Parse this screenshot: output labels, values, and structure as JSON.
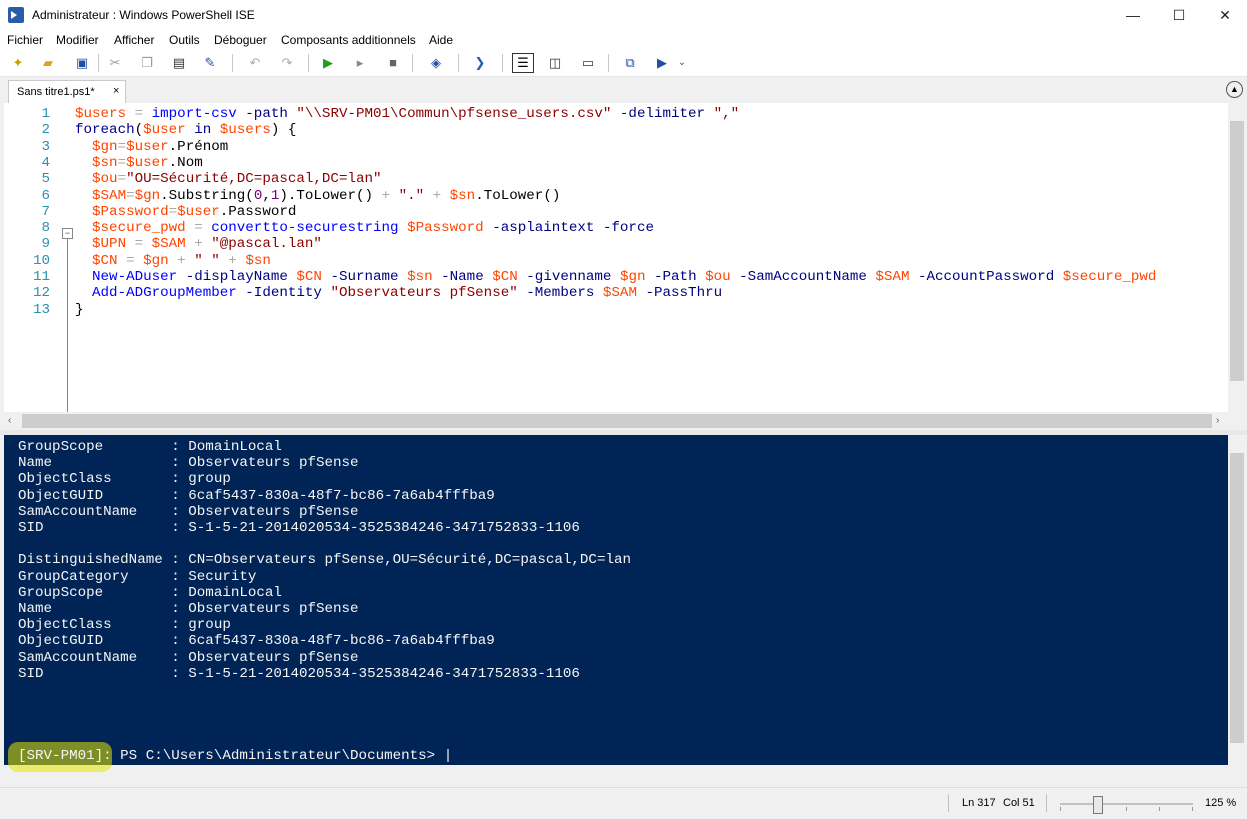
{
  "window": {
    "title": "Administrateur : Windows PowerShell ISE",
    "minimize_glyph": "—",
    "maximize_glyph": "☐",
    "close_glyph": "✕"
  },
  "menu": [
    "Fichier",
    "Modifier",
    "Afficher",
    "Outils",
    "Déboguer",
    "Composants additionnels",
    "Aide"
  ],
  "toolbar_icons": [
    "new-file-icon",
    "open-folder-icon",
    "save-icon",
    "cut-icon",
    "copy-icon",
    "paste-icon",
    "clear-icon",
    "undo-icon",
    "redo-icon",
    "run-icon",
    "run-selection-icon",
    "stop-icon",
    "remote-icon",
    "powershell-icon",
    "layout-top-icon",
    "layout-right-icon",
    "layout-max-icon",
    "show-commands-icon",
    "command-addon-icon",
    "overflow-icon"
  ],
  "tab": {
    "label": "Sans titre1.ps1*",
    "close": "×"
  },
  "editor": {
    "lines": [
      {
        "n": "1",
        "tokens": [
          [
            "var",
            "$users"
          ],
          [
            "op",
            " = "
          ],
          [
            "cmd",
            "import-csv"
          ],
          [
            "plain",
            " "
          ],
          [
            "param",
            "-path"
          ],
          [
            "plain",
            " "
          ],
          [
            "str",
            "\"\\\\SRV-PM01\\Commun\\pfsense_users.csv\""
          ],
          [
            "plain",
            " "
          ],
          [
            "param",
            "-delimiter"
          ],
          [
            "plain",
            " "
          ],
          [
            "str",
            "\",\""
          ]
        ]
      },
      {
        "n": "2",
        "tokens": [
          [
            "kw",
            "foreach"
          ],
          [
            "plain",
            "("
          ],
          [
            "var",
            "$user"
          ],
          [
            "plain",
            " "
          ],
          [
            "kw",
            "in"
          ],
          [
            "plain",
            " "
          ],
          [
            "var",
            "$users"
          ],
          [
            "plain",
            ") {"
          ]
        ]
      },
      {
        "n": "3",
        "tokens": [
          [
            "plain",
            "  "
          ],
          [
            "var",
            "$gn"
          ],
          [
            "op",
            "="
          ],
          [
            "var",
            "$user"
          ],
          [
            "plain",
            ".Prénom"
          ]
        ]
      },
      {
        "n": "4",
        "tokens": [
          [
            "plain",
            "  "
          ],
          [
            "var",
            "$sn"
          ],
          [
            "op",
            "="
          ],
          [
            "var",
            "$user"
          ],
          [
            "plain",
            ".Nom"
          ]
        ]
      },
      {
        "n": "5",
        "tokens": [
          [
            "plain",
            "  "
          ],
          [
            "var",
            "$ou"
          ],
          [
            "op",
            "="
          ],
          [
            "str",
            "\"OU=Sécurité,DC=pascal,DC=lan\""
          ]
        ]
      },
      {
        "n": "6",
        "tokens": [
          [
            "plain",
            "  "
          ],
          [
            "var",
            "$SAM"
          ],
          [
            "op",
            "="
          ],
          [
            "var",
            "$gn"
          ],
          [
            "plain",
            ".Substring("
          ],
          [
            "num",
            "0"
          ],
          [
            "plain",
            ","
          ],
          [
            "num",
            "1"
          ],
          [
            "plain",
            ").ToLower()"
          ],
          [
            "op",
            " + "
          ],
          [
            "str",
            "\".\""
          ],
          [
            "op",
            " + "
          ],
          [
            "var",
            "$sn"
          ],
          [
            "plain",
            ".ToLower()"
          ]
        ]
      },
      {
        "n": "7",
        "tokens": [
          [
            "plain",
            "  "
          ],
          [
            "var",
            "$Password"
          ],
          [
            "op",
            "="
          ],
          [
            "var",
            "$user"
          ],
          [
            "plain",
            ".Password"
          ]
        ]
      },
      {
        "n": "8",
        "tokens": [
          [
            "plain",
            "  "
          ],
          [
            "var",
            "$secure_pwd"
          ],
          [
            "op",
            " = "
          ],
          [
            "cmd",
            "convertto-securestring"
          ],
          [
            "plain",
            " "
          ],
          [
            "var",
            "$Password"
          ],
          [
            "plain",
            " "
          ],
          [
            "param",
            "-asplaintext"
          ],
          [
            "plain",
            " "
          ],
          [
            "param",
            "-force"
          ]
        ]
      },
      {
        "n": "9",
        "tokens": [
          [
            "plain",
            "  "
          ],
          [
            "var",
            "$UPN"
          ],
          [
            "op",
            " = "
          ],
          [
            "var",
            "$SAM"
          ],
          [
            "op",
            " + "
          ],
          [
            "str",
            "\"@pascal.lan\""
          ]
        ]
      },
      {
        "n": "10",
        "tokens": [
          [
            "plain",
            "  "
          ],
          [
            "var",
            "$CN"
          ],
          [
            "op",
            " = "
          ],
          [
            "var",
            "$gn"
          ],
          [
            "op",
            " + "
          ],
          [
            "str",
            "\" \""
          ],
          [
            "op",
            " + "
          ],
          [
            "var",
            "$sn"
          ]
        ]
      },
      {
        "n": "11",
        "tokens": [
          [
            "plain",
            "  "
          ],
          [
            "cmd",
            "New-ADuser"
          ],
          [
            "plain",
            " "
          ],
          [
            "param",
            "-displayName"
          ],
          [
            "plain",
            " "
          ],
          [
            "var",
            "$CN"
          ],
          [
            "plain",
            " "
          ],
          [
            "param",
            "-Surname"
          ],
          [
            "plain",
            " "
          ],
          [
            "var",
            "$sn"
          ],
          [
            "plain",
            " "
          ],
          [
            "param",
            "-Name"
          ],
          [
            "plain",
            " "
          ],
          [
            "var",
            "$CN"
          ],
          [
            "plain",
            " "
          ],
          [
            "param",
            "-givenname"
          ],
          [
            "plain",
            " "
          ],
          [
            "var",
            "$gn"
          ],
          [
            "plain",
            " "
          ],
          [
            "param",
            "-Path"
          ],
          [
            "plain",
            " "
          ],
          [
            "var",
            "$ou"
          ],
          [
            "plain",
            " "
          ],
          [
            "param",
            "-SamAccountName"
          ],
          [
            "plain",
            " "
          ],
          [
            "var",
            "$SAM"
          ],
          [
            "plain",
            " "
          ],
          [
            "param",
            "-AccountPassword"
          ],
          [
            "plain",
            " "
          ],
          [
            "var",
            "$secure_pwd"
          ]
        ]
      },
      {
        "n": "12",
        "tokens": [
          [
            "plain",
            "  "
          ],
          [
            "cmd",
            "Add-ADGroupMember"
          ],
          [
            "plain",
            " "
          ],
          [
            "param",
            "-Identity"
          ],
          [
            "plain",
            " "
          ],
          [
            "str",
            "\"Observateurs pfSense\""
          ],
          [
            "plain",
            " "
          ],
          [
            "param",
            "-Members"
          ],
          [
            "plain",
            " "
          ],
          [
            "var",
            "$SAM"
          ],
          [
            "plain",
            " "
          ],
          [
            "param",
            "-PassThru"
          ]
        ]
      },
      {
        "n": "13",
        "tokens": [
          [
            "plain",
            "}"
          ]
        ]
      }
    ]
  },
  "console": {
    "lines": [
      "GroupScope        : DomainLocal",
      "Name              : Observateurs pfSense",
      "ObjectClass       : group",
      "ObjectGUID        : 6caf5437-830a-48f7-bc86-7a6ab4fffba9",
      "SamAccountName    : Observateurs pfSense",
      "SID               : S-1-5-21-2014020534-3525384246-3471752833-1106",
      "",
      "DistinguishedName : CN=Observateurs pfSense,OU=Sécurité,DC=pascal,DC=lan",
      "GroupCategory     : Security",
      "GroupScope        : DomainLocal",
      "Name              : Observateurs pfSense",
      "ObjectClass       : group",
      "ObjectGUID        : 6caf5437-830a-48f7-bc86-7a6ab4fffba9",
      "SamAccountName    : Observateurs pfSense",
      "SID               : S-1-5-21-2014020534-3525384246-3471752833-1106"
    ],
    "prompt_host": "[SRV-PM01]",
    "prompt_rest": ": PS C:\\Users\\Administrateur\\Documents> |"
  },
  "status": {
    "line": "Ln 317",
    "col": "Col 51",
    "zoom": "125 %",
    "zoom_level_percent": 125
  },
  "colors": {
    "console_bg": "#012456",
    "variable": "#ff4500",
    "command": "#0000ff",
    "string": "#8b0000",
    "parameter": "#000080"
  }
}
